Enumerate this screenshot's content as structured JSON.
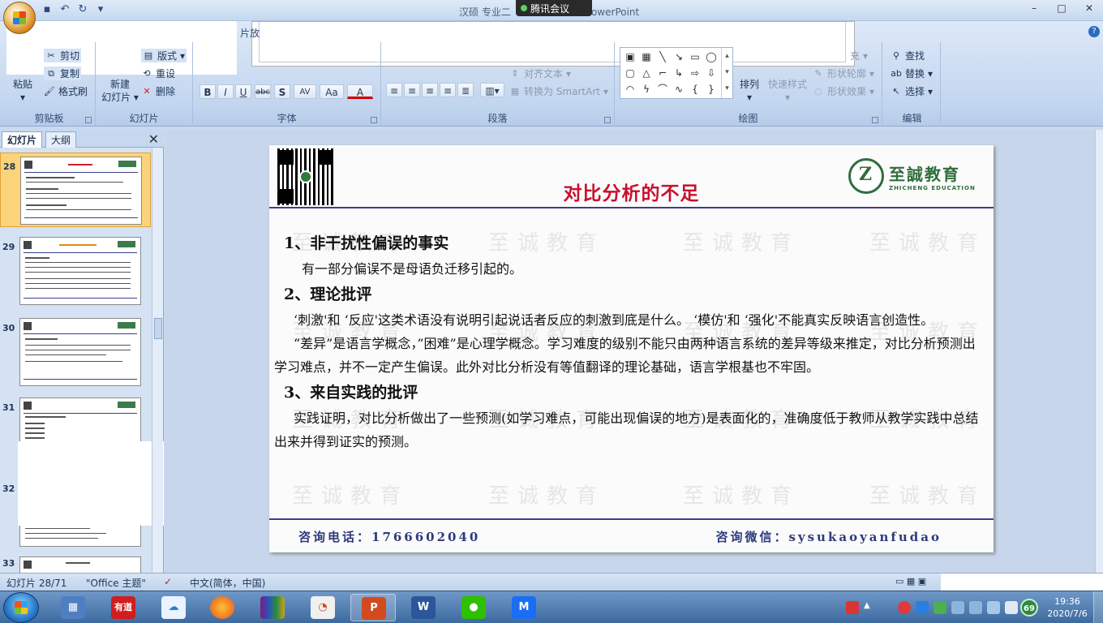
{
  "window": {
    "title_left": "汉硕 专业二 ",
    "title_right": "t PowerPoint",
    "meeting_app": "腾讯会议",
    "controls": [
      "–",
      "□",
      "✕"
    ]
  },
  "ribbon": {
    "help": "?",
    "clipboard": {
      "label": "剪贴板",
      "paste": "粘贴",
      "cut": "剪切",
      "copy": "复制",
      "format_painter": "格式刷"
    },
    "slides": {
      "label": "幻灯片",
      "new_slide_line1": "新建",
      "new_slide_line2": "幻灯片",
      "layout": "版式",
      "reset": "重设",
      "delete": "删除"
    },
    "font": {
      "label": "字体",
      "bold": "B",
      "italic": "I",
      "underline": "U",
      "strike": "abc",
      "shadow": "S",
      "spacing": "AV",
      "case": "Aa",
      "color": "A"
    },
    "paragraph": {
      "label": "段落",
      "align_text_partial": "对齐文本",
      "convert_smartart": "转换为 SmartArt"
    },
    "drawing": {
      "label": "绘图",
      "arrange": "排列",
      "quick_styles": "快速样式",
      "shape_fill_partial": "充",
      "shape_outline": "形状轮廓",
      "shape_effects": "形状效果"
    },
    "editing": {
      "label": "编辑",
      "find": "查找",
      "replace": "替换",
      "select": "选择"
    },
    "cut_tab_partial": "片放"
  },
  "panel": {
    "tabs": [
      "幻灯片",
      "大纲"
    ],
    "close": "✕",
    "thumbnails": [
      {
        "num": "28",
        "selected": true
      },
      {
        "num": "29",
        "selected": false
      },
      {
        "num": "30",
        "selected": false
      },
      {
        "num": "31",
        "selected": false
      },
      {
        "num": "32",
        "selected": false
      },
      {
        "num": "33",
        "selected": false
      }
    ]
  },
  "slide": {
    "title": "对比分析的不足",
    "watermark": "至诚教育",
    "logo_cn": "至誠教育",
    "logo_en": "ZHICHENG EDUCATION",
    "h1": "1、非干扰性偏误的事实",
    "p1": "有一部分偏误不是母语负迁移引起的。",
    "h2": "2、理论批评",
    "p2": "‘刺激'和 ‘反应'这类术语没有说明引起说话者反应的刺激到底是什么。 ‘模仿'和 ‘强化'不能真实反映语言创造性。",
    "p3": "“差异”是语言学概念，”困难”是心理学概念。学习难度的级别不能只由两种语言系统的差异等级来推定，对比分析预测出学习难点，并不一定产生偏误。此外对比分析没有等值翻译的理论基础，语言学根基也不牢固。",
    "h3": "3、来自实践的批评",
    "p4": "实践证明，对比分析做出了一些预测(如学习难点，可能出现偏误的地方)是表面化的，准确度低于教师从教学实践中总结出来并得到证实的预测。",
    "footer_phone": "咨询电话：1766602040",
    "footer_wechat": "咨询微信：sysukaoyanfudao"
  },
  "statusbar": {
    "slide_count": "幻灯片 28/71",
    "theme": "\"Office 主题\"",
    "language": "中文(简体，中国)"
  },
  "taskbar": {
    "youdao": "有道",
    "time": "19:36",
    "date": "2020/7/6",
    "badge": "69"
  }
}
